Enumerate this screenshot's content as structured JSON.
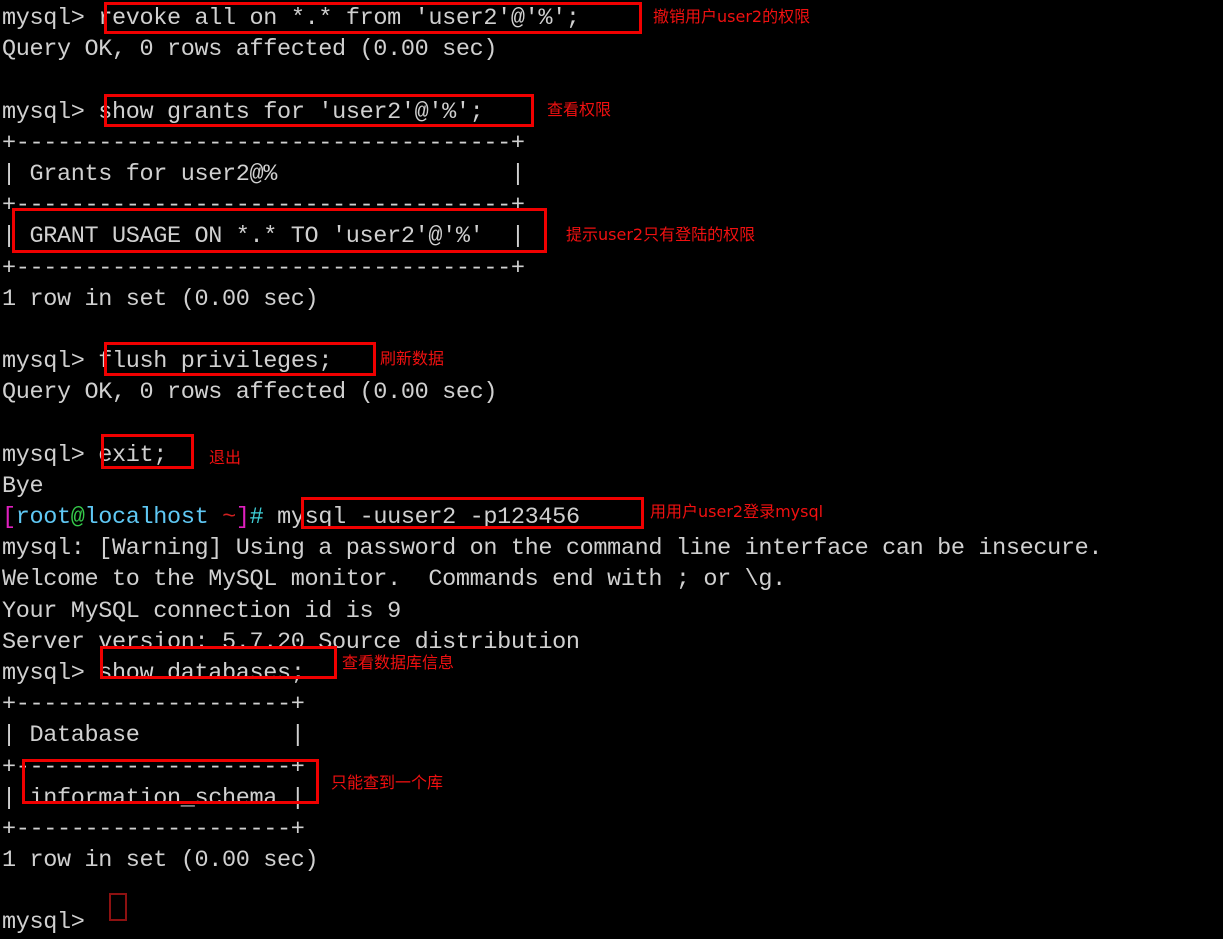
{
  "terminal": {
    "title": "MySQL Terminal Session",
    "background_color": "#000000",
    "foreground_color": "#d0d0d0",
    "highlight_color": "#f00000",
    "annotation_color": "#f01010",
    "prompt_mysql": "mysql>",
    "cursor_color": "#8d1111"
  },
  "lines": {
    "l01_prompt": "mysql> ",
    "l01_cmd": "revoke all on *.* from 'user2'@'%';",
    "l02": "Query OK, 0 rows affected (0.00 sec)",
    "l03": "",
    "l04_prompt": "mysql> ",
    "l04_cmd": "show grants for 'user2'@'%';",
    "l05": "+------------------------------------+",
    "l06": "| Grants for user2@%                 |",
    "l07": "+------------------------------------+",
    "l08": "| GRANT USAGE ON *.* TO 'user2'@'%'  |",
    "l09": "+------------------------------------+",
    "l10": "1 row in set (0.00 sec)",
    "l11": "",
    "l12_prompt": "mysql> ",
    "l12_cmd": "flush privileges;",
    "l13": "Query OK, 0 rows affected (0.00 sec)",
    "l14": "",
    "l15_prompt": "mysql> ",
    "l15_cmd": "exit;",
    "l16": "Bye",
    "l17_b1": "[",
    "l17_user": "root",
    "l17_at": "@",
    "l17_host": "localhost",
    "l17_space": " ",
    "l17_tilde": "~",
    "l17_b2": "]",
    "l17_hash": "# ",
    "l17_cmd": "mysql -uuser2 -p123456",
    "l18": "mysql: [Warning] Using a password on the command line interface can be insecure.",
    "l19": "Welcome to the MySQL monitor.  Commands end with ; or \\g.",
    "l20": "Your MySQL connection id is 9",
    "l21": "Server version: 5.7.20 Source distribution",
    "l22_prompt": "mysql> ",
    "l22_cmd": "show databases;",
    "l23": "+--------------------+",
    "l24": "| Database           |",
    "l25": "+--------------------+",
    "l26": "| information_schema |",
    "l27": "+--------------------+",
    "l28": "1 row in set (0.00 sec)",
    "l29": "",
    "l30_prompt": "mysql> "
  },
  "annotations": [
    {
      "id": "a1",
      "text": "撤销用户user2的权限"
    },
    {
      "id": "a2",
      "text": "查看权限"
    },
    {
      "id": "a3",
      "text": "提示user2只有登陆的权限"
    },
    {
      "id": "a4",
      "text": "刷新数据"
    },
    {
      "id": "a5",
      "text": "退出"
    },
    {
      "id": "a6",
      "text": "用用户user2登录mysql"
    },
    {
      "id": "a7",
      "text": "查看数据库信息"
    },
    {
      "id": "a8",
      "text": "只能查到一个库"
    }
  ]
}
